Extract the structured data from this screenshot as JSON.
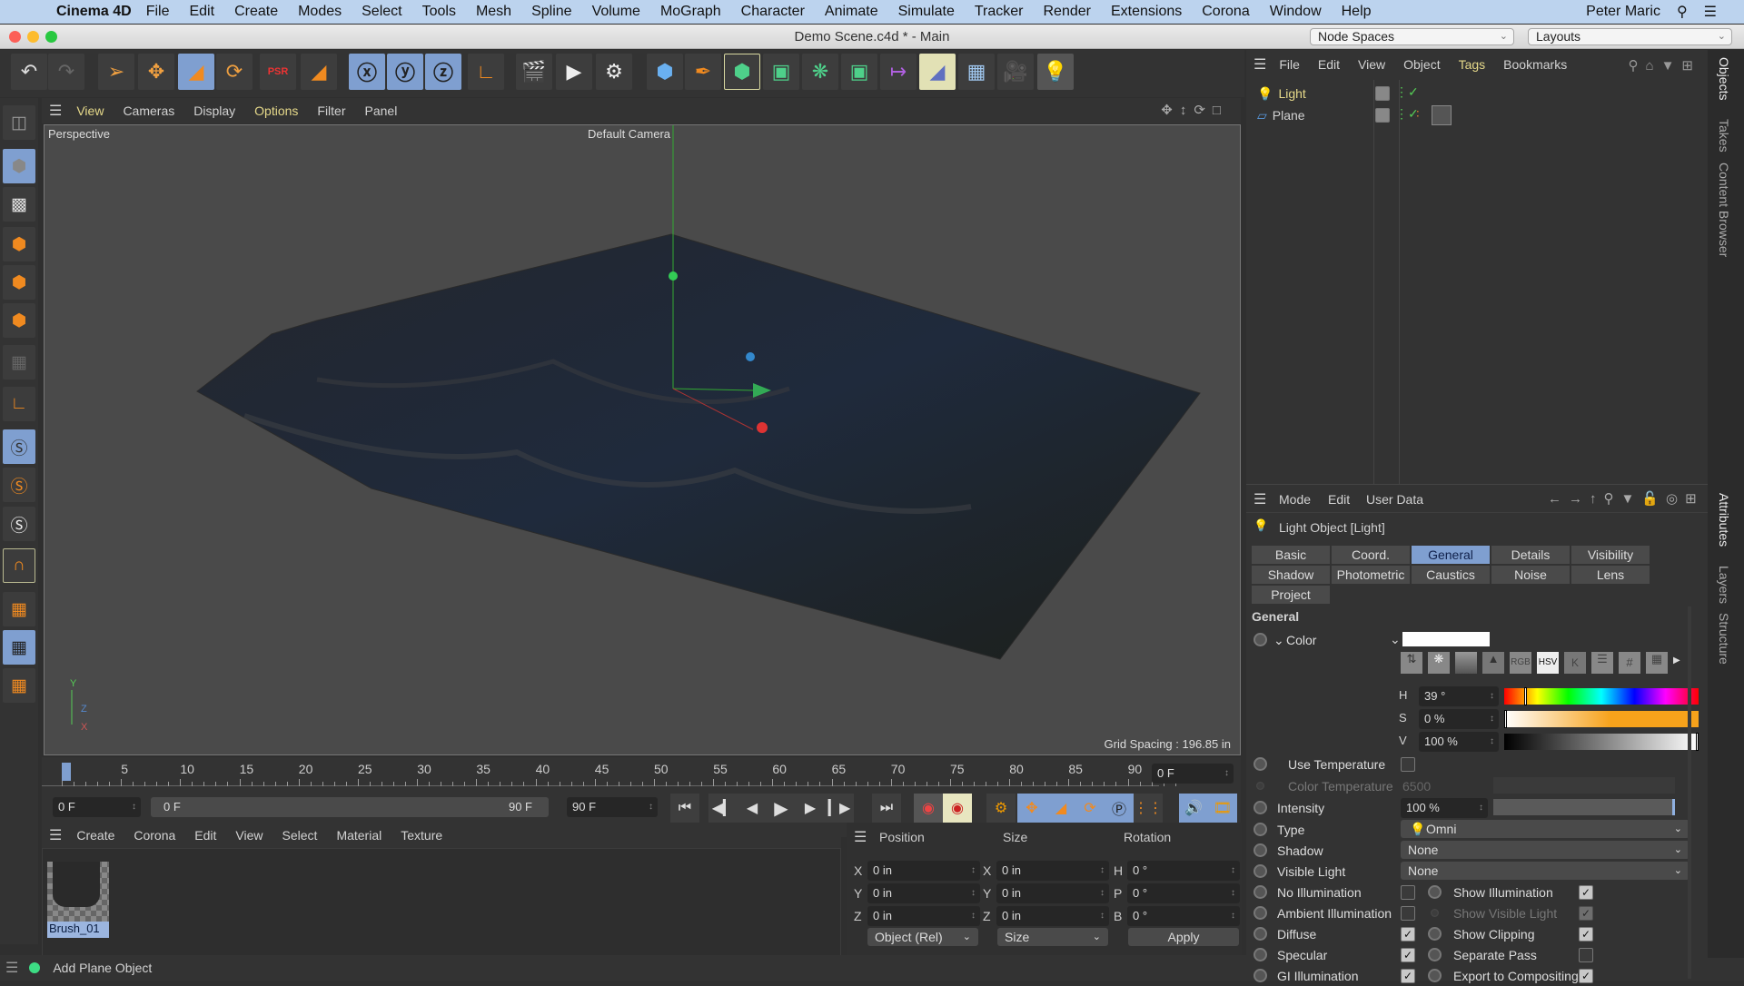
{
  "menubar": {
    "app_name": "Cinema 4D",
    "items": [
      "File",
      "Edit",
      "Create",
      "Modes",
      "Select",
      "Tools",
      "Mesh",
      "Spline",
      "Volume",
      "MoGraph",
      "Character",
      "Animate",
      "Simulate",
      "Tracker",
      "Render",
      "Extensions",
      "Corona",
      "Window",
      "Help"
    ],
    "user": "Peter Maric"
  },
  "window": {
    "title": "Demo Scene.c4d * - Main",
    "node_spaces": "Node Spaces",
    "layouts": "Layouts"
  },
  "viewport": {
    "menu": [
      "View",
      "Cameras",
      "Display",
      "Options",
      "Filter",
      "Panel"
    ],
    "view_name": "Perspective",
    "camera": "Default Camera",
    "grid_spacing": "Grid Spacing : 196.85 in"
  },
  "timeline": {
    "ticks": [
      "0",
      "5",
      "10",
      "15",
      "20",
      "25",
      "30",
      "35",
      "40",
      "45",
      "50",
      "55",
      "60",
      "65",
      "70",
      "75",
      "80",
      "85",
      "90"
    ],
    "current_frame": "0 F",
    "start": "0 F",
    "range_start": "0 F",
    "range_end": "90 F",
    "end": "90 F"
  },
  "materials": {
    "menu": [
      "Create",
      "Corona",
      "Edit",
      "View",
      "Select",
      "Material",
      "Texture"
    ],
    "items": [
      {
        "name": "Brush_01"
      }
    ]
  },
  "coordinates": {
    "headers": [
      "Position",
      "Size",
      "Rotation"
    ],
    "rows": [
      {
        "pl": "X",
        "pv": "0 in",
        "sl": "X",
        "sv": "0 in",
        "rl": "H",
        "rv": "0 °"
      },
      {
        "pl": "Y",
        "pv": "0 in",
        "sl": "Y",
        "sv": "0 in",
        "rl": "P",
        "rv": "0 °"
      },
      {
        "pl": "Z",
        "pv": "0 in",
        "sl": "Z",
        "sv": "0 in",
        "rl": "B",
        "rv": "0 °"
      }
    ],
    "mode": "Object (Rel)",
    "size_mode": "Size",
    "apply": "Apply"
  },
  "status": {
    "text": "Add Plane Object"
  },
  "objects": {
    "menu": [
      "File",
      "Edit",
      "View",
      "Object",
      "Tags",
      "Bookmarks"
    ],
    "items": [
      {
        "name": "Light",
        "selected": true
      },
      {
        "name": "Plane",
        "selected": false
      }
    ]
  },
  "attributes": {
    "menu": [
      "Mode",
      "Edit",
      "User Data"
    ],
    "object_title": "Light Object [Light]",
    "tabs": [
      "Basic",
      "Coord.",
      "General",
      "Details",
      "Visibility",
      "Shadow",
      "Photometric",
      "Caustics",
      "Noise",
      "Lens",
      "Project"
    ],
    "active_tab": "General",
    "section": "General",
    "color_label": "Color",
    "color_modes": [
      "RGB",
      "HSV",
      "K",
      "#"
    ],
    "hsv": {
      "h_label": "H",
      "h": "39 °",
      "s_label": "S",
      "s": "0 %",
      "v_label": "V",
      "v": "100 %"
    },
    "use_temperature": "Use Temperature",
    "color_temperature": "Color Temperature",
    "color_temperature_value": "6500",
    "intensity": "Intensity",
    "intensity_value": "100 %",
    "type": "Type",
    "type_value": "Omni",
    "shadow": "Shadow",
    "shadow_value": "None",
    "visible_light": "Visible Light",
    "visible_light_value": "None",
    "checks_left": [
      {
        "label": "No Illumination",
        "checked": false
      },
      {
        "label": "Ambient Illumination",
        "checked": false
      },
      {
        "label": "Diffuse",
        "checked": true
      },
      {
        "label": "Specular",
        "checked": true
      },
      {
        "label": "GI Illumination",
        "checked": true
      }
    ],
    "checks_right": [
      {
        "label": "Show Illumination",
        "checked": true
      },
      {
        "label": "Show Visible Light",
        "checked": true
      },
      {
        "label": "Show Clipping",
        "checked": true
      },
      {
        "label": "Separate Pass",
        "checked": false
      },
      {
        "label": "Export to Compositing",
        "checked": true
      }
    ]
  },
  "side_tabs": {
    "top": [
      "Objects",
      "Takes",
      "Content Browser"
    ],
    "bottom": [
      "Attributes",
      "Layers",
      "Structure"
    ]
  },
  "colors": {
    "accent": "#7f9fd0",
    "menubar": "#bcd3ee",
    "highlight_text": "#e6d98a"
  }
}
